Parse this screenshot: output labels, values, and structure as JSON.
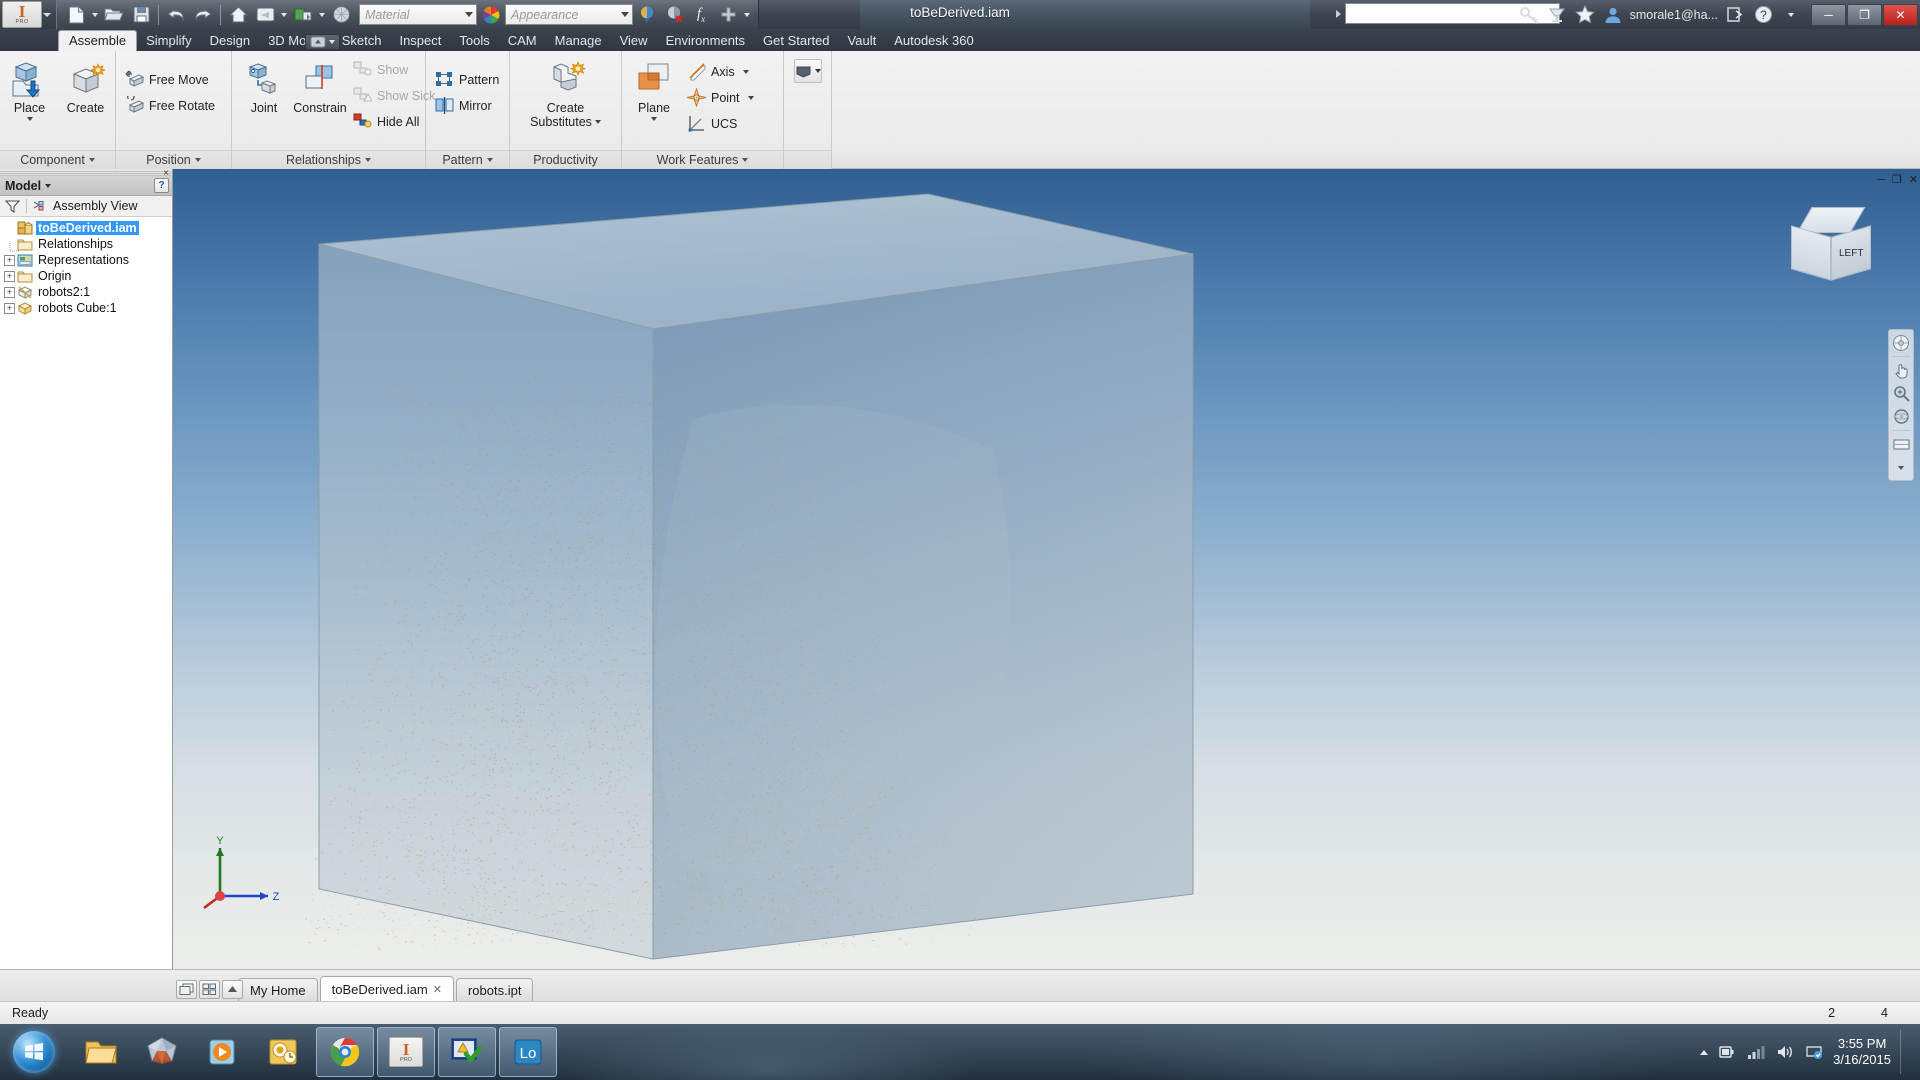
{
  "app": {
    "product": "Autodesk Inventor Professional",
    "logo_glyph": "I",
    "logo_sub": "PRO",
    "document_title": "toBeDerived.iam"
  },
  "quick_access": {
    "items": [
      {
        "name": "new-file-icon",
        "label": "New"
      },
      {
        "name": "open-file-icon",
        "label": "Open"
      },
      {
        "name": "save-icon",
        "label": "Save"
      },
      {
        "name": "undo-icon",
        "label": "Undo"
      },
      {
        "name": "redo-icon",
        "label": "Redo"
      },
      {
        "name": "home-icon",
        "label": "Home"
      },
      {
        "name": "return-icon",
        "label": "Return"
      },
      {
        "name": "update-icon",
        "label": "Update"
      },
      {
        "name": "appearance-sphere-icon",
        "label": "Appearance"
      }
    ],
    "material_value": "",
    "material_placeholder": "Material",
    "appearance_value": "",
    "appearance_placeholder": "Appearance",
    "extra_icons": [
      {
        "name": "adjust-appearance-icon",
        "label": "Adjust"
      },
      {
        "name": "clear-appearance-icon",
        "label": "Clear Appearance"
      },
      {
        "name": "parameters-fx-icon",
        "label": "Parameters"
      },
      {
        "name": "add-icon",
        "label": "Add"
      }
    ]
  },
  "title_right": {
    "search_value": "",
    "search_placeholder": "",
    "icons": [
      {
        "name": "sign-in-key-icon",
        "label": "Sign In"
      },
      {
        "name": "autodesk-exchange-icon",
        "label": "Autodesk Exchange"
      },
      {
        "name": "favorites-star-icon",
        "label": "Favorites"
      },
      {
        "name": "user-account-icon",
        "label": "Account"
      }
    ],
    "user": "smorale1@ha...",
    "help_label": "?",
    "close_x_label": "✕"
  },
  "window_controls": {
    "minimize": "─",
    "maximize": "❐",
    "close": "✕"
  },
  "ribbon": {
    "tabs": [
      {
        "label": "Assemble",
        "active": true
      },
      {
        "label": "Simplify",
        "active": false
      },
      {
        "label": "Design",
        "active": false
      },
      {
        "label": "3D Model",
        "active": false
      },
      {
        "label": "Sketch",
        "active": false
      },
      {
        "label": "Inspect",
        "active": false
      },
      {
        "label": "Tools",
        "active": false
      },
      {
        "label": "CAM",
        "active": false
      },
      {
        "label": "Manage",
        "active": false
      },
      {
        "label": "View",
        "active": false
      },
      {
        "label": "Environments",
        "active": false
      },
      {
        "label": "Get Started",
        "active": false
      },
      {
        "label": "Vault",
        "active": false
      },
      {
        "label": "Autodesk 360",
        "active": false
      }
    ],
    "panels": [
      {
        "title": "Component",
        "has_caret": true,
        "big_buttons": [
          {
            "name": "place-component-button",
            "label": "Place",
            "label2": "",
            "icon": "place-component-icon",
            "dropdown": true
          },
          {
            "name": "create-component-button",
            "label": "Create",
            "label2": "",
            "icon": "create-component-icon",
            "dropdown": false
          }
        ],
        "small_buttons": []
      },
      {
        "title": "Position",
        "has_caret": true,
        "big_buttons": [],
        "small_buttons": [
          {
            "name": "free-move-button",
            "label": "Free Move",
            "icon": "free-move-icon",
            "disabled": false,
            "dropdown": false
          },
          {
            "name": "free-rotate-button",
            "label": "Free Rotate",
            "icon": "free-rotate-icon",
            "disabled": false,
            "dropdown": false
          }
        ]
      },
      {
        "title": "Relationships",
        "has_caret": true,
        "big_buttons": [
          {
            "name": "joint-button",
            "label": "Joint",
            "label2": "",
            "icon": "joint-icon",
            "dropdown": false
          },
          {
            "name": "constrain-button",
            "label": "Constrain",
            "label2": "",
            "icon": "constrain-icon",
            "dropdown": false
          }
        ],
        "small_buttons": [
          {
            "name": "show-relationships-button",
            "label": "Show",
            "icon": "show-relationships-icon",
            "disabled": true,
            "dropdown": false
          },
          {
            "name": "show-sick-button",
            "label": "Show Sick",
            "icon": "show-sick-icon",
            "disabled": true,
            "dropdown": false
          },
          {
            "name": "hide-all-button",
            "label": "Hide All",
            "icon": "hide-all-icon",
            "disabled": false,
            "dropdown": false
          }
        ]
      },
      {
        "title": "Pattern",
        "has_caret": true,
        "big_buttons": [],
        "small_buttons": [
          {
            "name": "pattern-button",
            "label": "Pattern",
            "icon": "pattern-icon",
            "disabled": false,
            "dropdown": false
          },
          {
            "name": "mirror-button",
            "label": "Mirror",
            "icon": "mirror-icon",
            "disabled": false,
            "dropdown": false
          }
        ]
      },
      {
        "title": "Productivity",
        "has_caret": false,
        "big_buttons": [
          {
            "name": "create-substitutes-button",
            "label": "Create",
            "label2": "Substitutes",
            "icon": "create-substitutes-icon",
            "dropdown": true
          }
        ],
        "small_buttons": []
      },
      {
        "title": "Work Features",
        "has_caret": true,
        "big_buttons": [
          {
            "name": "plane-button",
            "label": "Plane",
            "label2": "",
            "icon": "work-plane-icon",
            "dropdown": true
          }
        ],
        "small_buttons": [
          {
            "name": "axis-button",
            "label": "Axis",
            "icon": "work-axis-icon",
            "disabled": false,
            "dropdown": true
          },
          {
            "name": "point-button",
            "label": "Point",
            "icon": "work-point-icon",
            "disabled": false,
            "dropdown": true
          },
          {
            "name": "ucs-button",
            "label": "UCS",
            "icon": "ucs-icon",
            "disabled": false,
            "dropdown": false
          }
        ]
      }
    ],
    "overflow_dropdown": "more-panels-dropdown"
  },
  "browser": {
    "panel_title": "Model",
    "help_label": "?",
    "filter_icon": "filter-funnel-icon",
    "view_label": "Assembly View",
    "view_icon": "assembly-view-icon",
    "close_label": "×",
    "tree": [
      {
        "label": "toBeDerived.iam",
        "depth": 0,
        "icon": "assembly-doc-icon",
        "expander": "none",
        "selected": true
      },
      {
        "label": "Relationships",
        "depth": 1,
        "icon": "folder-icon",
        "expander": "none",
        "selected": false
      },
      {
        "label": "Representations",
        "depth": 1,
        "icon": "representations-icon",
        "expander": "plus",
        "selected": false
      },
      {
        "label": "Origin",
        "depth": 1,
        "icon": "folder-icon",
        "expander": "plus",
        "selected": false
      },
      {
        "label": "robots2:1",
        "depth": 1,
        "icon": "part-suppressed-icon",
        "expander": "plus",
        "selected": false
      },
      {
        "label": "robots Cube:1",
        "depth": 1,
        "icon": "part-icon",
        "expander": "plus",
        "selected": false
      }
    ]
  },
  "viewport": {
    "view_cube_face": "LEFT",
    "axis_labels": {
      "x": "",
      "y": "Y",
      "z": "Z"
    },
    "minimize_label": "─",
    "restore_label": "❐",
    "close_label": "✕",
    "nav_tools": [
      {
        "name": "full-navigation-wheel-icon",
        "label": "Full Navigation Wheel"
      },
      {
        "name": "pan-icon",
        "label": "Pan"
      },
      {
        "name": "zoom-icon",
        "label": "Zoom"
      },
      {
        "name": "orbit-icon",
        "label": "Orbit"
      },
      {
        "name": "look-at-icon",
        "label": "Look At"
      }
    ]
  },
  "doc_tabs": {
    "tools": [
      {
        "name": "cascade-windows-icon",
        "label": "Cascade"
      },
      {
        "name": "tile-windows-icon",
        "label": "Tile"
      },
      {
        "name": "scroll-tabs-icon",
        "label": "Scroll"
      }
    ],
    "tabs": [
      {
        "label": "My Home",
        "active": false,
        "closable": false
      },
      {
        "label": "toBeDerived.iam",
        "active": true,
        "closable": true
      },
      {
        "label": "robots.ipt",
        "active": false,
        "closable": false
      }
    ],
    "close_glyph": "✕"
  },
  "status_bar": {
    "message": "Ready",
    "right_values": [
      "2",
      "4"
    ]
  },
  "taskbar": {
    "start_label": "Start",
    "apps": [
      {
        "name": "windows-explorer-taskbar-icon",
        "label": "File Explorer",
        "active": false
      },
      {
        "name": "polyhedron-app-taskbar-icon",
        "label": "3D Viewer",
        "active": false
      },
      {
        "name": "media-player-taskbar-icon",
        "label": "Media Player",
        "active": false
      },
      {
        "name": "outlook-taskbar-icon",
        "label": "Outlook",
        "active": false
      },
      {
        "name": "chrome-taskbar-icon",
        "label": "Google Chrome",
        "active": true
      },
      {
        "name": "inventor-taskbar-icon",
        "label": "Autodesk Inventor",
        "active": true
      },
      {
        "name": "image-viewer-taskbar-icon",
        "label": "Image Viewer",
        "active": true
      },
      {
        "name": "logitech-taskbar-icon",
        "label": "Logitech",
        "active": true
      }
    ],
    "tray": [
      {
        "name": "show-hidden-icons-caret",
        "label": "Show hidden icons"
      },
      {
        "name": "battery-tray-icon",
        "label": "Battery"
      },
      {
        "name": "network-signal-tray-icon",
        "label": "Network"
      },
      {
        "name": "volume-tray-icon",
        "label": "Volume"
      },
      {
        "name": "action-center-tray-icon",
        "label": "Action Center"
      }
    ],
    "clock_time": "3:55 PM",
    "clock_date": "3/16/2015"
  }
}
